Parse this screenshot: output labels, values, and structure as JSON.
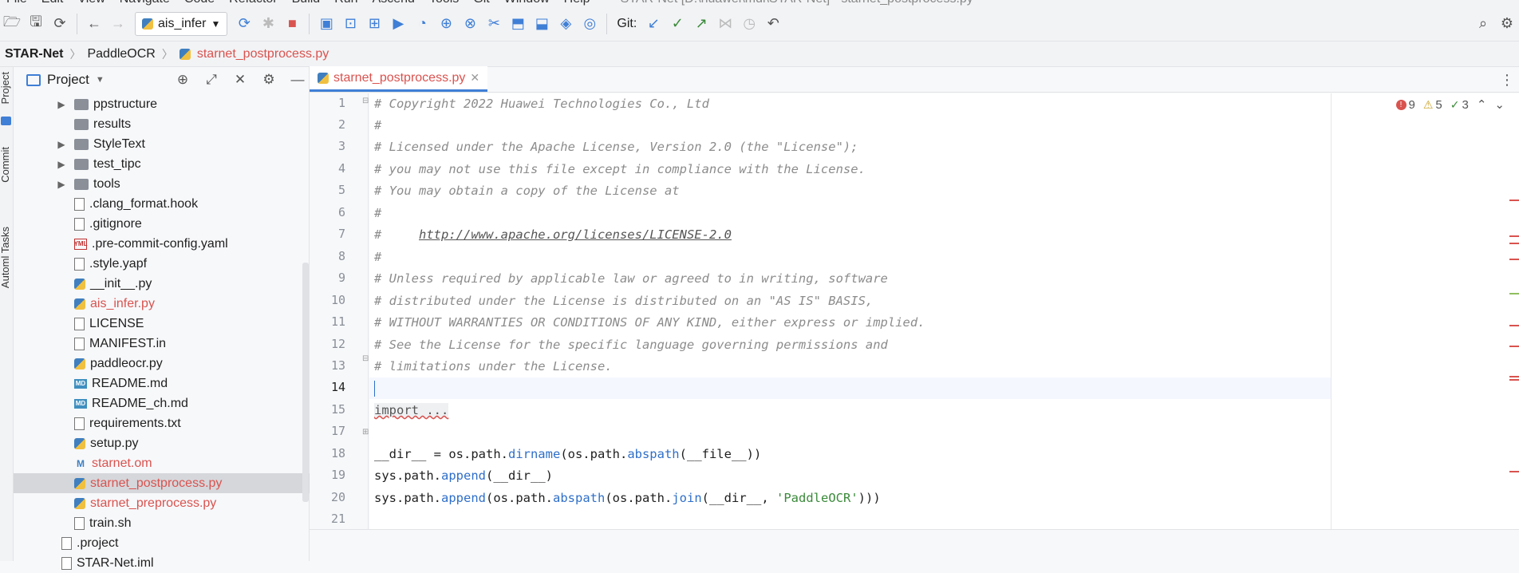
{
  "menu": [
    "File",
    "Edit",
    "View",
    "Navigate",
    "Code",
    "Refactor",
    "Build",
    "Run",
    "Ascend",
    "Tools",
    "Git",
    "Window",
    "Help"
  ],
  "window_title": "STAR-Net [D:\\huawei\\mdl\\STAR-Net] - starnet_postprocess.py",
  "toolbar": {
    "run_config": "ais_infer",
    "git_label": "Git:"
  },
  "breadcrumb": [
    "STAR-Net",
    "PaddleOCR",
    "starnet_postprocess.py"
  ],
  "left_tabs": [
    "Project",
    "Commit",
    "Automl Tasks"
  ],
  "project_panel": {
    "title": "Project"
  },
  "tree": [
    {
      "name": "ppstructure",
      "kind": "folder",
      "expandable": true,
      "indent": 1
    },
    {
      "name": "results",
      "kind": "folder",
      "expandable": false,
      "indent": 1
    },
    {
      "name": "StyleText",
      "kind": "folder",
      "expandable": true,
      "indent": 1
    },
    {
      "name": "test_tipc",
      "kind": "folder",
      "expandable": true,
      "indent": 1
    },
    {
      "name": "tools",
      "kind": "folder",
      "expandable": true,
      "indent": 1
    },
    {
      "name": ".clang_format.hook",
      "kind": "file",
      "indent": 1
    },
    {
      "name": ".gitignore",
      "kind": "file",
      "indent": 1
    },
    {
      "name": ".pre-commit-config.yaml",
      "kind": "yaml",
      "indent": 1
    },
    {
      "name": ".style.yapf",
      "kind": "file",
      "indent": 1
    },
    {
      "name": "__init__.py",
      "kind": "py",
      "indent": 1
    },
    {
      "name": "ais_infer.py",
      "kind": "py",
      "indent": 1,
      "modified": true
    },
    {
      "name": "LICENSE",
      "kind": "file",
      "indent": 1
    },
    {
      "name": "MANIFEST.in",
      "kind": "file",
      "indent": 1
    },
    {
      "name": "paddleocr.py",
      "kind": "py",
      "indent": 1
    },
    {
      "name": "README.md",
      "kind": "md",
      "indent": 1
    },
    {
      "name": "README_ch.md",
      "kind": "md",
      "indent": 1
    },
    {
      "name": "requirements.txt",
      "kind": "file",
      "indent": 1
    },
    {
      "name": "setup.py",
      "kind": "py",
      "indent": 1
    },
    {
      "name": "starnet.om",
      "kind": "om",
      "indent": 1,
      "modified": true
    },
    {
      "name": "starnet_postprocess.py",
      "kind": "py",
      "indent": 1,
      "modified": true,
      "selected": true
    },
    {
      "name": "starnet_preprocess.py",
      "kind": "py",
      "indent": 1,
      "modified": true
    },
    {
      "name": "train.sh",
      "kind": "file",
      "indent": 1
    },
    {
      "name": ".project",
      "kind": "file",
      "indent": 0
    },
    {
      "name": "STAR-Net.iml",
      "kind": "file",
      "indent": 0
    }
  ],
  "editor": {
    "tab_label": "starnet_postprocess.py",
    "inspections": {
      "errors": "9",
      "warnings": "5",
      "weak": "3"
    },
    "line_numbers": [
      "1",
      "2",
      "3",
      "4",
      "5",
      "6",
      "7",
      "8",
      "9",
      "10",
      "11",
      "12",
      "13",
      "14",
      "15",
      "17",
      "18",
      "19",
      "20",
      "21"
    ],
    "current_line": "14"
  },
  "code": {
    "l1": "# Copyright 2022 Huawei Technologies Co., Ltd",
    "l2": "#",
    "l3": "# Licensed under the Apache License, Version 2.0 (the \"License\");",
    "l4": "# you may not use this file except in compliance with the License.",
    "l5": "# You may obtain a copy of the License at",
    "l6": "#",
    "l7_prefix": "#     ",
    "l7_url": "http://www.apache.org/licenses/LICENSE-2.0",
    "l8": "#",
    "l9": "# Unless required by applicable law or agreed to in writing, software",
    "l10": "# distributed under the License is distributed on an \"AS IS\" BASIS,",
    "l11": "# WITHOUT WARRANTIES OR CONDITIONS OF ANY KIND, either express or implied.",
    "l12": "# See the License for the specific language governing permissions and",
    "l13": "# limitations under the License.",
    "l15": "import ...",
    "l18_a": "__dir__",
    "l18_b": " = os.path.",
    "l18_c": "dirname",
    "l18_d": "(os.path.",
    "l18_e": "abspath",
    "l18_f": "(",
    "l18_g": "__file__",
    "l18_h": "))",
    "l19_a": "sys.path.",
    "l19_b": "append",
    "l19_c": "(",
    "l19_d": "__dir__",
    "l19_e": ")",
    "l20_a": "sys.path.",
    "l20_b": "append",
    "l20_c": "(os.path.",
    "l20_d": "abspath",
    "l20_e": "(os.path.",
    "l20_f": "join",
    "l20_g": "(",
    "l20_h": "__dir__",
    "l20_i": ", ",
    "l20_j": "'PaddleOCR'",
    "l20_k": ")))"
  }
}
